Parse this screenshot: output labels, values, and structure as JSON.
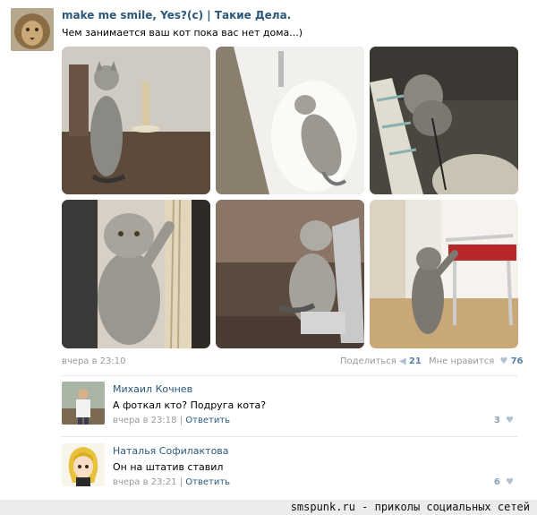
{
  "post": {
    "author": "make me smile, Yes?(c) | Такие Дела.",
    "text": "Чем занимается ваш кот пока вас нет дома...)",
    "avatar_icon": "lion-avatar",
    "photos": [
      {
        "icon": "cat-standing-photo"
      },
      {
        "icon": "cat-in-bathtub-photo"
      },
      {
        "icon": "cat-biting-post-photo"
      },
      {
        "icon": "cat-on-scratching-post-photo"
      },
      {
        "icon": "cat-on-sofa-laptop-photo"
      },
      {
        "icon": "cat-by-chair-photo"
      }
    ],
    "time": "вчера в 23:10",
    "share_label": "Поделиться",
    "share_count": "21",
    "like_label": "Мне нравится",
    "like_count": "76"
  },
  "comments": [
    {
      "name": "Михаил Кочнев",
      "text": "А фоткал кто? Подруга кота?",
      "time": "вчера в 23:18",
      "reply": "Ответить",
      "likes": "3",
      "avatar_icon": "man-avatar"
    },
    {
      "name": "Наталья Софилактова",
      "text": "Он на штатив ставил",
      "time": "вчера в 23:21",
      "reply": "Ответить",
      "likes": "6",
      "avatar_icon": "anime-girl-avatar"
    }
  ],
  "footer": {
    "text": "smspunk.ru - приколы социальных сетей"
  },
  "colors": {
    "link": "#2b587a",
    "muted": "#999999",
    "footer_bg": "#ececec"
  }
}
